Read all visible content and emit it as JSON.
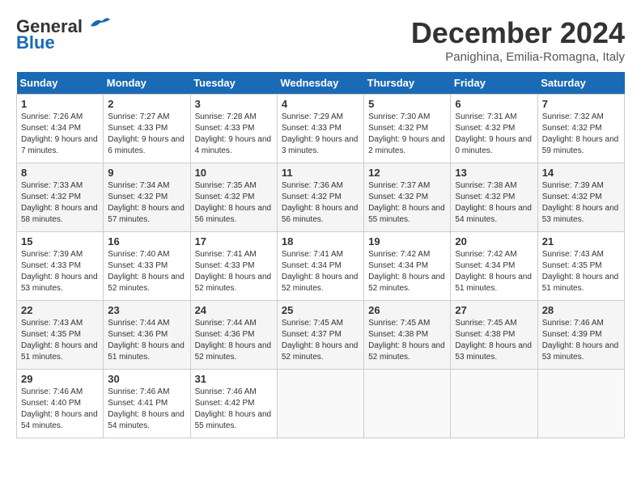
{
  "header": {
    "logo_general": "General",
    "logo_blue": "Blue",
    "month_title": "December 2024",
    "subtitle": "Panighina, Emilia-Romagna, Italy"
  },
  "days_of_week": [
    "Sunday",
    "Monday",
    "Tuesday",
    "Wednesday",
    "Thursday",
    "Friday",
    "Saturday"
  ],
  "weeks": [
    [
      {
        "day": "1",
        "sunrise": "7:26 AM",
        "sunset": "4:34 PM",
        "daylight": "9 hours and 7 minutes."
      },
      {
        "day": "2",
        "sunrise": "7:27 AM",
        "sunset": "4:33 PM",
        "daylight": "9 hours and 6 minutes."
      },
      {
        "day": "3",
        "sunrise": "7:28 AM",
        "sunset": "4:33 PM",
        "daylight": "9 hours and 4 minutes."
      },
      {
        "day": "4",
        "sunrise": "7:29 AM",
        "sunset": "4:33 PM",
        "daylight": "9 hours and 3 minutes."
      },
      {
        "day": "5",
        "sunrise": "7:30 AM",
        "sunset": "4:32 PM",
        "daylight": "9 hours and 2 minutes."
      },
      {
        "day": "6",
        "sunrise": "7:31 AM",
        "sunset": "4:32 PM",
        "daylight": "9 hours and 0 minutes."
      },
      {
        "day": "7",
        "sunrise": "7:32 AM",
        "sunset": "4:32 PM",
        "daylight": "8 hours and 59 minutes."
      }
    ],
    [
      {
        "day": "8",
        "sunrise": "7:33 AM",
        "sunset": "4:32 PM",
        "daylight": "8 hours and 58 minutes."
      },
      {
        "day": "9",
        "sunrise": "7:34 AM",
        "sunset": "4:32 PM",
        "daylight": "8 hours and 57 minutes."
      },
      {
        "day": "10",
        "sunrise": "7:35 AM",
        "sunset": "4:32 PM",
        "daylight": "8 hours and 56 minutes."
      },
      {
        "day": "11",
        "sunrise": "7:36 AM",
        "sunset": "4:32 PM",
        "daylight": "8 hours and 56 minutes."
      },
      {
        "day": "12",
        "sunrise": "7:37 AM",
        "sunset": "4:32 PM",
        "daylight": "8 hours and 55 minutes."
      },
      {
        "day": "13",
        "sunrise": "7:38 AM",
        "sunset": "4:32 PM",
        "daylight": "8 hours and 54 minutes."
      },
      {
        "day": "14",
        "sunrise": "7:39 AM",
        "sunset": "4:32 PM",
        "daylight": "8 hours and 53 minutes."
      }
    ],
    [
      {
        "day": "15",
        "sunrise": "7:39 AM",
        "sunset": "4:33 PM",
        "daylight": "8 hours and 53 minutes."
      },
      {
        "day": "16",
        "sunrise": "7:40 AM",
        "sunset": "4:33 PM",
        "daylight": "8 hours and 52 minutes."
      },
      {
        "day": "17",
        "sunrise": "7:41 AM",
        "sunset": "4:33 PM",
        "daylight": "8 hours and 52 minutes."
      },
      {
        "day": "18",
        "sunrise": "7:41 AM",
        "sunset": "4:34 PM",
        "daylight": "8 hours and 52 minutes."
      },
      {
        "day": "19",
        "sunrise": "7:42 AM",
        "sunset": "4:34 PM",
        "daylight": "8 hours and 52 minutes."
      },
      {
        "day": "20",
        "sunrise": "7:42 AM",
        "sunset": "4:34 PM",
        "daylight": "8 hours and 51 minutes."
      },
      {
        "day": "21",
        "sunrise": "7:43 AM",
        "sunset": "4:35 PM",
        "daylight": "8 hours and 51 minutes."
      }
    ],
    [
      {
        "day": "22",
        "sunrise": "7:43 AM",
        "sunset": "4:35 PM",
        "daylight": "8 hours and 51 minutes."
      },
      {
        "day": "23",
        "sunrise": "7:44 AM",
        "sunset": "4:36 PM",
        "daylight": "8 hours and 51 minutes."
      },
      {
        "day": "24",
        "sunrise": "7:44 AM",
        "sunset": "4:36 PM",
        "daylight": "8 hours and 52 minutes."
      },
      {
        "day": "25",
        "sunrise": "7:45 AM",
        "sunset": "4:37 PM",
        "daylight": "8 hours and 52 minutes."
      },
      {
        "day": "26",
        "sunrise": "7:45 AM",
        "sunset": "4:38 PM",
        "daylight": "8 hours and 52 minutes."
      },
      {
        "day": "27",
        "sunrise": "7:45 AM",
        "sunset": "4:38 PM",
        "daylight": "8 hours and 53 minutes."
      },
      {
        "day": "28",
        "sunrise": "7:46 AM",
        "sunset": "4:39 PM",
        "daylight": "8 hours and 53 minutes."
      }
    ],
    [
      {
        "day": "29",
        "sunrise": "7:46 AM",
        "sunset": "4:40 PM",
        "daylight": "8 hours and 54 minutes."
      },
      {
        "day": "30",
        "sunrise": "7:46 AM",
        "sunset": "4:41 PM",
        "daylight": "8 hours and 54 minutes."
      },
      {
        "day": "31",
        "sunrise": "7:46 AM",
        "sunset": "4:42 PM",
        "daylight": "8 hours and 55 minutes."
      },
      null,
      null,
      null,
      null
    ]
  ]
}
